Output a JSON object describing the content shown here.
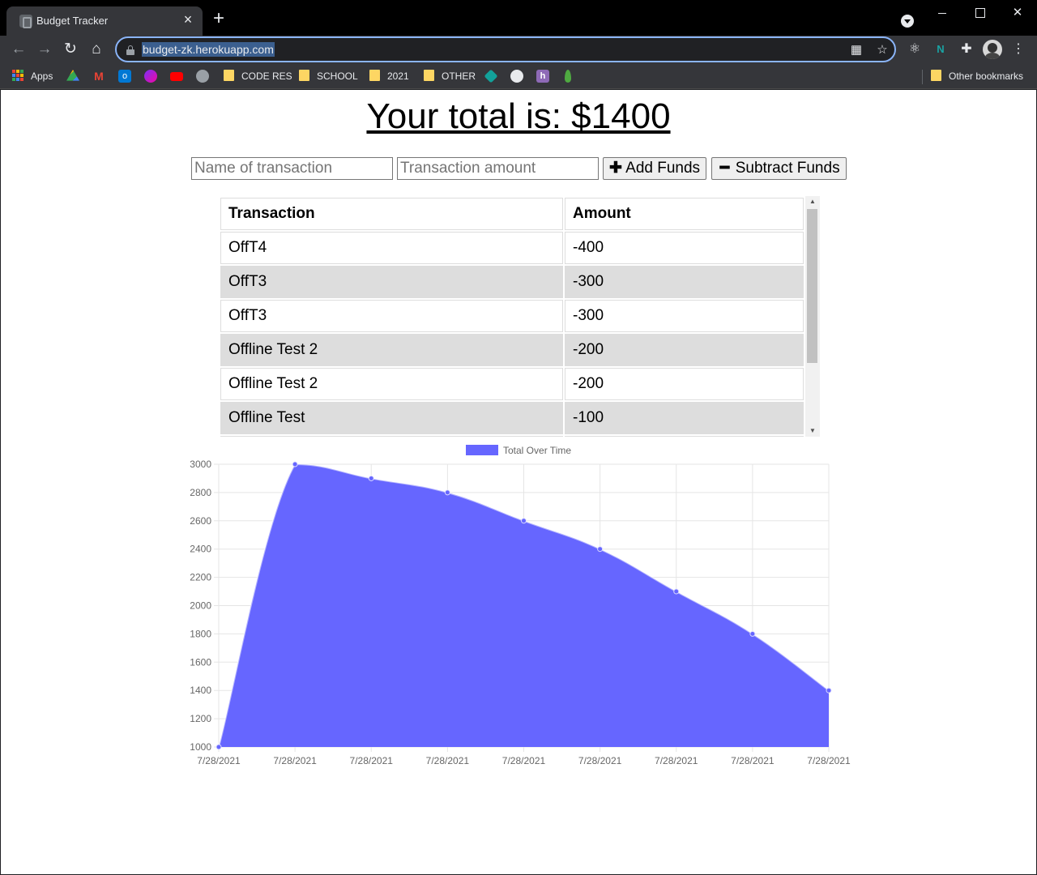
{
  "browser": {
    "tab_title": "Budget Tracker",
    "url": "budget-zk.herokuapp.com",
    "bookmarks": [
      {
        "label": "Apps",
        "type": "apps"
      },
      {
        "label": "CODE RES",
        "type": "folder"
      },
      {
        "label": "SCHOOL",
        "type": "folder"
      },
      {
        "label": "2021",
        "type": "folder"
      },
      {
        "label": "OTHER",
        "type": "folder"
      }
    ],
    "other_bookmarks": "Other bookmarks"
  },
  "page": {
    "total_text": "Your total is: $1400",
    "form": {
      "name_placeholder": "Name of transaction",
      "amount_placeholder": "Transaction amount",
      "add_label": "Add Funds",
      "subtract_label": "Subtract Funds"
    },
    "table": {
      "headers": [
        "Transaction",
        "Amount"
      ],
      "rows": [
        {
          "name": "OffT4",
          "amount": "-400"
        },
        {
          "name": "OffT3",
          "amount": "-300"
        },
        {
          "name": "OffT3",
          "amount": "-300"
        },
        {
          "name": "Offline Test 2",
          "amount": "-200"
        },
        {
          "name": "Offline Test 2",
          "amount": "-200"
        },
        {
          "name": "Offline Test",
          "amount": "-100"
        }
      ]
    }
  },
  "chart_data": {
    "type": "area",
    "x": [
      "7/28/2021",
      "7/28/2021",
      "7/28/2021",
      "7/28/2021",
      "7/28/2021",
      "7/28/2021",
      "7/28/2021",
      "7/28/2021",
      "7/28/2021"
    ],
    "series": [
      {
        "name": "Total Over Time",
        "values": [
          1000,
          3000,
          2900,
          2800,
          2600,
          2400,
          2100,
          1800,
          1400
        ],
        "color": "#6666ff"
      }
    ],
    "ylim": [
      1000,
      3000
    ],
    "yticks": [
      1000,
      1200,
      1400,
      1600,
      1800,
      2000,
      2200,
      2400,
      2600,
      2800,
      3000
    ],
    "grid": true,
    "legend": "top"
  }
}
